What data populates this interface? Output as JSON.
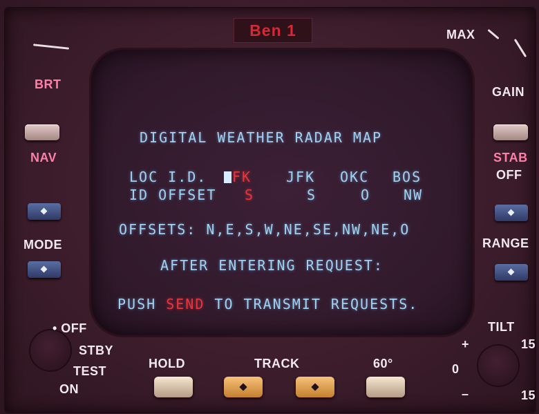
{
  "brand": "Ben 1",
  "left_panel": {
    "brt": "BRT",
    "nav": "NAV",
    "mode": "MODE",
    "off": "• OFF",
    "stby": "STBY",
    "test": "TEST",
    "on": "ON"
  },
  "right_panel": {
    "max": "MAX",
    "gain": "GAIN",
    "stab": "STAB",
    "stab_state": "OFF",
    "range": "RANGE",
    "tilt": "TILT",
    "tilt_plus": "+",
    "tilt_zero": "0",
    "tilt_minus": "–",
    "tilt_15_top": "15",
    "tilt_15_bottom": "15"
  },
  "bottom_buttons": {
    "hold": "HOLD",
    "track": "TRACK",
    "deg60": "60°"
  },
  "screen": {
    "title": "DIGITAL WEATHER RADAR MAP",
    "loc_label": "LOC I.D.",
    "loc_values": [
      "FK",
      "JFK",
      "OKC",
      "BOS"
    ],
    "offset_label": "ID OFFSET",
    "offset_values": [
      "S",
      "S",
      "O",
      "NW"
    ],
    "offsets_line": "OFFSETS: N,E,S,W,NE,SE,NW,NE,O",
    "after_line": "AFTER ENTERING REQUEST:",
    "push_prefix": "PUSH ",
    "push_send": "SEND",
    "push_suffix": " TO TRANSMIT REQUESTS."
  },
  "colors": {
    "crt_text": "#9fd2f2",
    "highlight": "#e8343c",
    "brand": "#d32a35"
  }
}
